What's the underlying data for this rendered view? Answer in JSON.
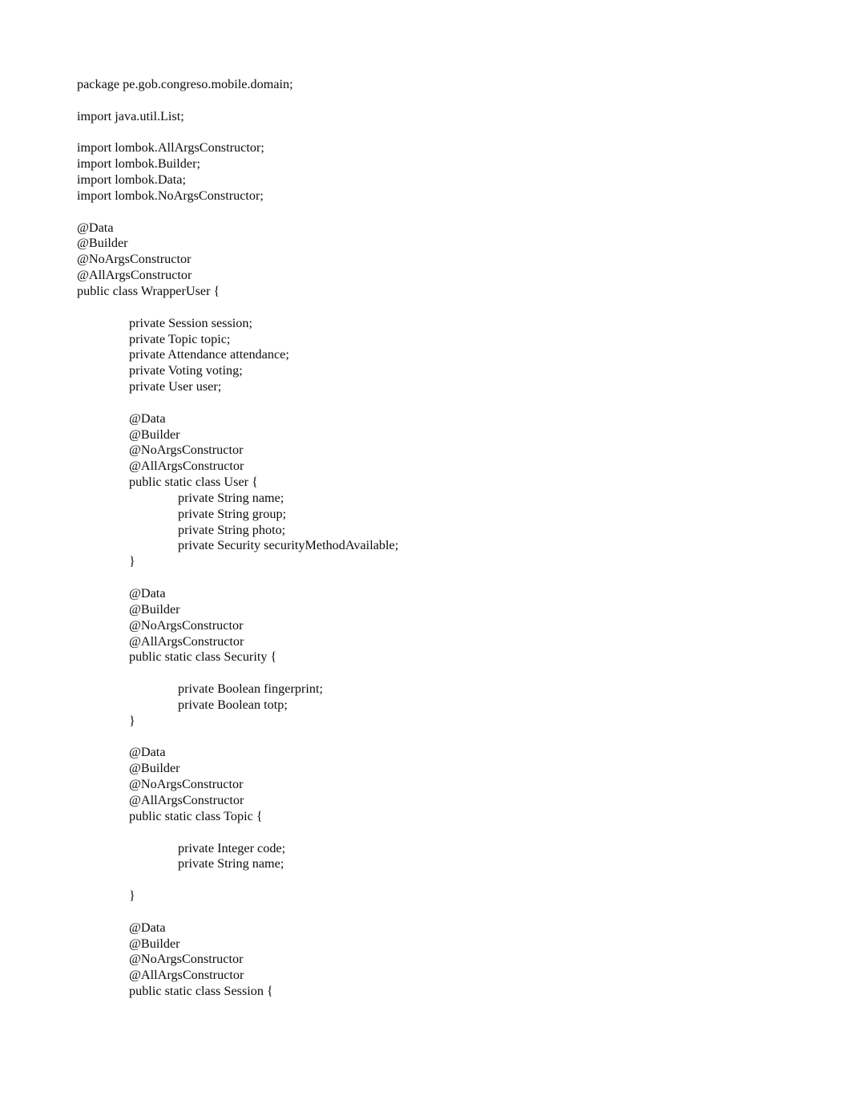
{
  "document": {
    "kind": "source-code-listing",
    "language": "Java",
    "page_background": "#ffffff",
    "text_color": "#0c0c0c",
    "code_lines": [
      {
        "indent": 0,
        "text": "package pe.gob.congreso.mobile.domain;"
      },
      {
        "indent": 0,
        "text": ""
      },
      {
        "indent": 0,
        "text": "import java.util.List;"
      },
      {
        "indent": 0,
        "text": ""
      },
      {
        "indent": 0,
        "text": "import lombok.AllArgsConstructor;"
      },
      {
        "indent": 0,
        "text": "import lombok.Builder;"
      },
      {
        "indent": 0,
        "text": "import lombok.Data;"
      },
      {
        "indent": 0,
        "text": "import lombok.NoArgsConstructor;"
      },
      {
        "indent": 0,
        "text": ""
      },
      {
        "indent": 0,
        "text": "@Data"
      },
      {
        "indent": 0,
        "text": "@Builder"
      },
      {
        "indent": 0,
        "text": "@NoArgsConstructor"
      },
      {
        "indent": 0,
        "text": "@AllArgsConstructor"
      },
      {
        "indent": 0,
        "text": "public class WrapperUser {"
      },
      {
        "indent": 0,
        "text": ""
      },
      {
        "indent": 1,
        "text": "private Session session;"
      },
      {
        "indent": 1,
        "text": "private Topic topic;"
      },
      {
        "indent": 1,
        "text": "private Attendance attendance;"
      },
      {
        "indent": 1,
        "text": "private Voting voting;"
      },
      {
        "indent": 1,
        "text": "private User user;"
      },
      {
        "indent": 0,
        "text": ""
      },
      {
        "indent": 1,
        "text": "@Data"
      },
      {
        "indent": 1,
        "text": "@Builder"
      },
      {
        "indent": 1,
        "text": "@NoArgsConstructor"
      },
      {
        "indent": 1,
        "text": "@AllArgsConstructor"
      },
      {
        "indent": 1,
        "text": "public static class User {"
      },
      {
        "indent": 2,
        "text": "private String name;"
      },
      {
        "indent": 2,
        "text": "private String group;"
      },
      {
        "indent": 2,
        "text": "private String photo;"
      },
      {
        "indent": 2,
        "text": "private Security securityMethodAvailable;"
      },
      {
        "indent": 1,
        "text": "}"
      },
      {
        "indent": 0,
        "text": ""
      },
      {
        "indent": 1,
        "text": "@Data"
      },
      {
        "indent": 1,
        "text": "@Builder"
      },
      {
        "indent": 1,
        "text": "@NoArgsConstructor"
      },
      {
        "indent": 1,
        "text": "@AllArgsConstructor"
      },
      {
        "indent": 1,
        "text": "public static class Security {"
      },
      {
        "indent": 0,
        "text": ""
      },
      {
        "indent": 2,
        "text": "private Boolean fingerprint;"
      },
      {
        "indent": 2,
        "text": "private Boolean totp;"
      },
      {
        "indent": 1,
        "text": "}"
      },
      {
        "indent": 0,
        "text": ""
      },
      {
        "indent": 1,
        "text": "@Data"
      },
      {
        "indent": 1,
        "text": "@Builder"
      },
      {
        "indent": 1,
        "text": "@NoArgsConstructor"
      },
      {
        "indent": 1,
        "text": "@AllArgsConstructor"
      },
      {
        "indent": 1,
        "text": "public static class Topic {"
      },
      {
        "indent": 0,
        "text": ""
      },
      {
        "indent": 2,
        "text": "private Integer code;"
      },
      {
        "indent": 2,
        "text": "private String name;"
      },
      {
        "indent": 0,
        "text": ""
      },
      {
        "indent": 1,
        "text": "}"
      },
      {
        "indent": 0,
        "text": ""
      },
      {
        "indent": 1,
        "text": "@Data"
      },
      {
        "indent": 1,
        "text": "@Builder"
      },
      {
        "indent": 1,
        "text": "@NoArgsConstructor"
      },
      {
        "indent": 1,
        "text": "@AllArgsConstructor"
      },
      {
        "indent": 1,
        "text": "public static class Session {"
      }
    ]
  }
}
